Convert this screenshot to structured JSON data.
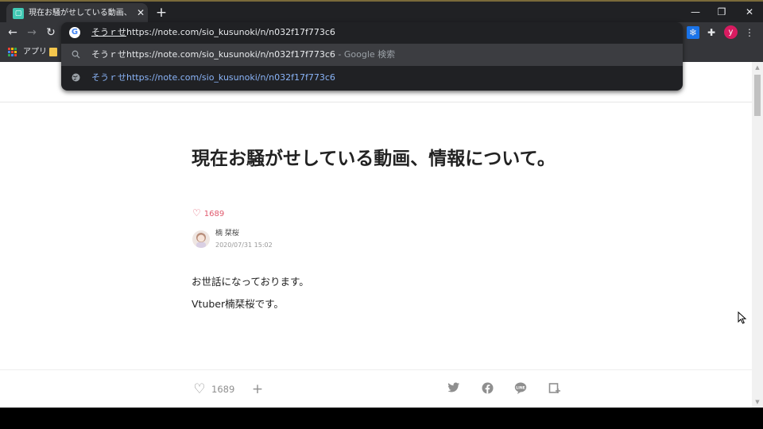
{
  "tab": {
    "title": "現在お騒がせしている動画、情報に...",
    "favicon": "note-favicon-icon"
  },
  "window_controls": {
    "minimize": "—",
    "restore": "❐",
    "close": "✕"
  },
  "toolbar": {
    "back": "←",
    "forward": "→",
    "reload": "↻",
    "profile_initial": "y"
  },
  "bookmarks": {
    "apps_label": "アプリ"
  },
  "omnibox": {
    "composing": "そうｒせ",
    "input_rest": "https://note.com/sio_kusunoki/n/n032f17f773c6",
    "suggestions": [
      {
        "icon": "search-icon",
        "text": "そうｒせhttps://note.com/sio_kusunoki/n/n032f17f773c6",
        "suffix": " - Google 検索"
      },
      {
        "icon": "globe-icon",
        "text": "そうｒせhttps://note.com/sio_kusunoki/n/n032f17f773c6"
      }
    ]
  },
  "article": {
    "title": "現在お騒がせしている動画、情報について。",
    "likes": "1689",
    "author": "楠 栞桜",
    "date": "2020/07/31 15:02",
    "paragraphs": [
      "お世話になっております。",
      "Vtuber楠栞桜です。"
    ]
  },
  "footer": {
    "like_count": "1689",
    "add": "+"
  },
  "colors": {
    "accent_green": "#2cb696",
    "like_pink": "#e0596d",
    "link_blue": "#8ab4f8"
  }
}
